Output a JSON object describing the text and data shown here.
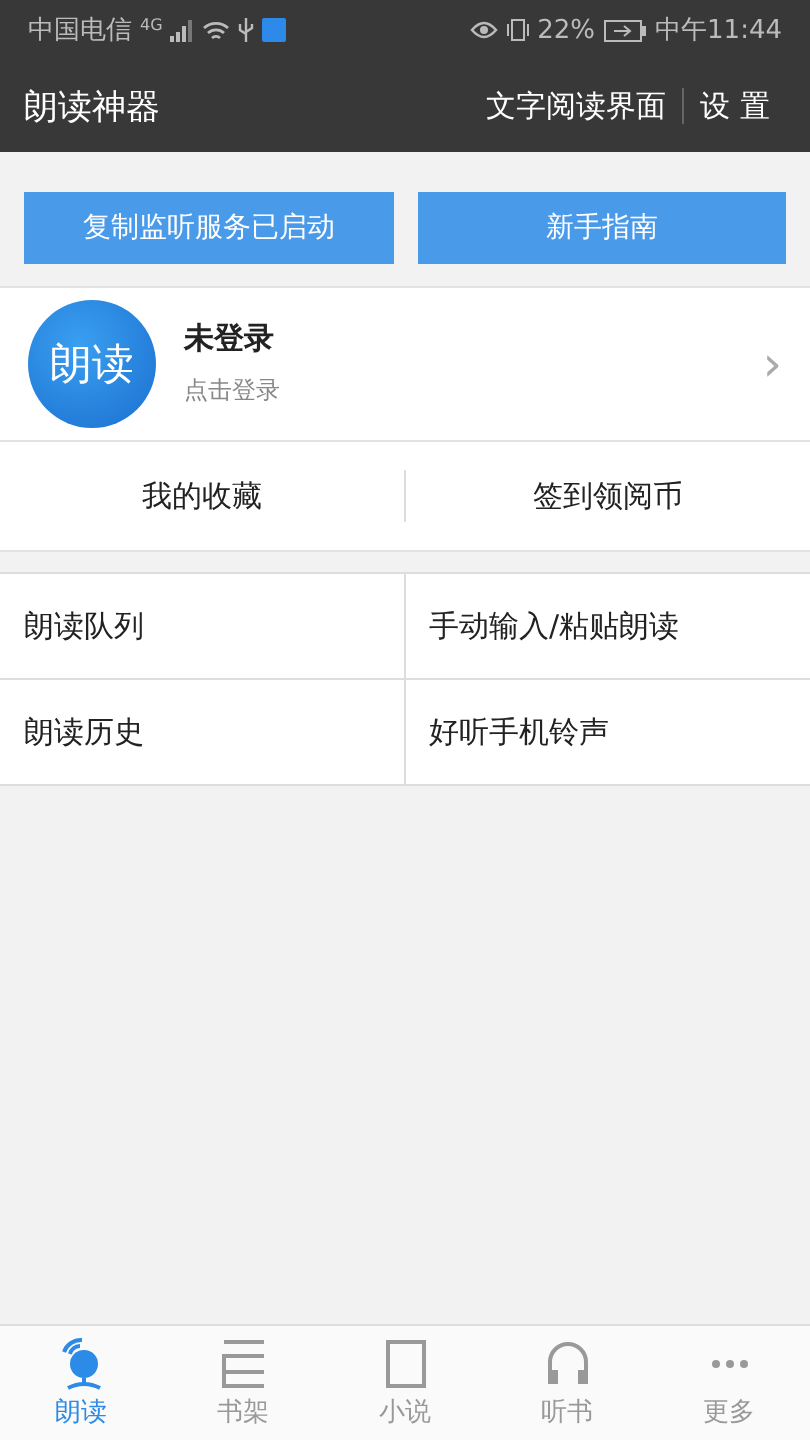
{
  "status_bar": {
    "carrier": "中国电信",
    "network": "4G",
    "battery": "22%",
    "time": "中午11:44"
  },
  "header": {
    "title": "朗读神器",
    "actions": [
      "文字阅读界面",
      "设 置"
    ]
  },
  "buttons": [
    "复制监听服务已启动",
    "新手指南"
  ],
  "profile": {
    "avatar_text": "朗读",
    "name": "未登录",
    "hint": "点击登录",
    "chevron": "›"
  },
  "quick_links": [
    "我的收藏",
    "签到领阅币"
  ],
  "menu": [
    {
      "label": "朗读队列"
    },
    {
      "label": "手动输入/粘贴朗读"
    },
    {
      "label": "朗读历史"
    },
    {
      "label": "好听手机铃声"
    }
  ],
  "tab_bar": [
    {
      "label": "朗读",
      "selected": true
    },
    {
      "label": "书架",
      "selected": false
    },
    {
      "label": "小说",
      "selected": false
    },
    {
      "label": "听书",
      "selected": false
    },
    {
      "label": "更多",
      "selected": false
    }
  ]
}
